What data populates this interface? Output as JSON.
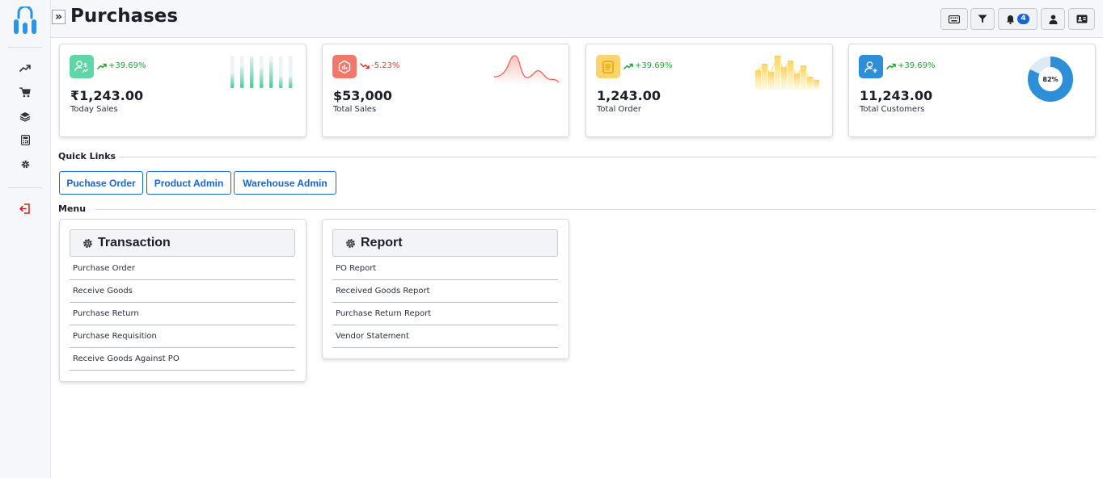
{
  "header": {
    "title": "Purchases",
    "notification_count": "4"
  },
  "sidebar": {
    "icons": [
      "trending-up-icon",
      "cart-icon",
      "layers-icon",
      "calculator-icon",
      "gear-icon",
      "logout-icon"
    ]
  },
  "stats": [
    {
      "value": "₹1,243.00",
      "label": "Today Sales",
      "change": "+39.69%",
      "trend": "up",
      "icon": "user-dollar-icon",
      "icon_color": "#5fd6a6"
    },
    {
      "value": "$53,000",
      "label": "Total Sales",
      "change": "-5.23%",
      "trend": "down",
      "icon": "chart-hexagon-icon",
      "icon_color": "#f2786c"
    },
    {
      "value": "1,243.00",
      "label": "Total Order",
      "change": "+39.69%",
      "trend": "up",
      "icon": "document-icon",
      "icon_color": "#ffd36b"
    },
    {
      "value": "11,243.00",
      "label": "Total Customers",
      "change": "+39.69%",
      "trend": "up",
      "icon": "user-add-icon",
      "icon_color": "#2e8fd8",
      "donut_value": "82%",
      "donut_percent": 82
    }
  ],
  "quick_links": {
    "label": "Quick Links",
    "items": [
      "Puchase Order",
      "Product Admin",
      "Warehouse Admin"
    ]
  },
  "menu": {
    "label": "Menu",
    "panels": [
      {
        "title": "Transaction",
        "items": [
          "Purchase Order",
          "Receive Goods",
          "Purchase Return",
          "Purchase Requisition",
          "Receive Goods Against PO"
        ]
      },
      {
        "title": "Report",
        "items": [
          "PO Report",
          "Received Goods Report",
          "Purchase Return Report",
          "Vendor Statement"
        ]
      }
    ]
  },
  "colors": {
    "accent": "#1565d8",
    "up": "#18a82e",
    "down": "#e0382d"
  }
}
